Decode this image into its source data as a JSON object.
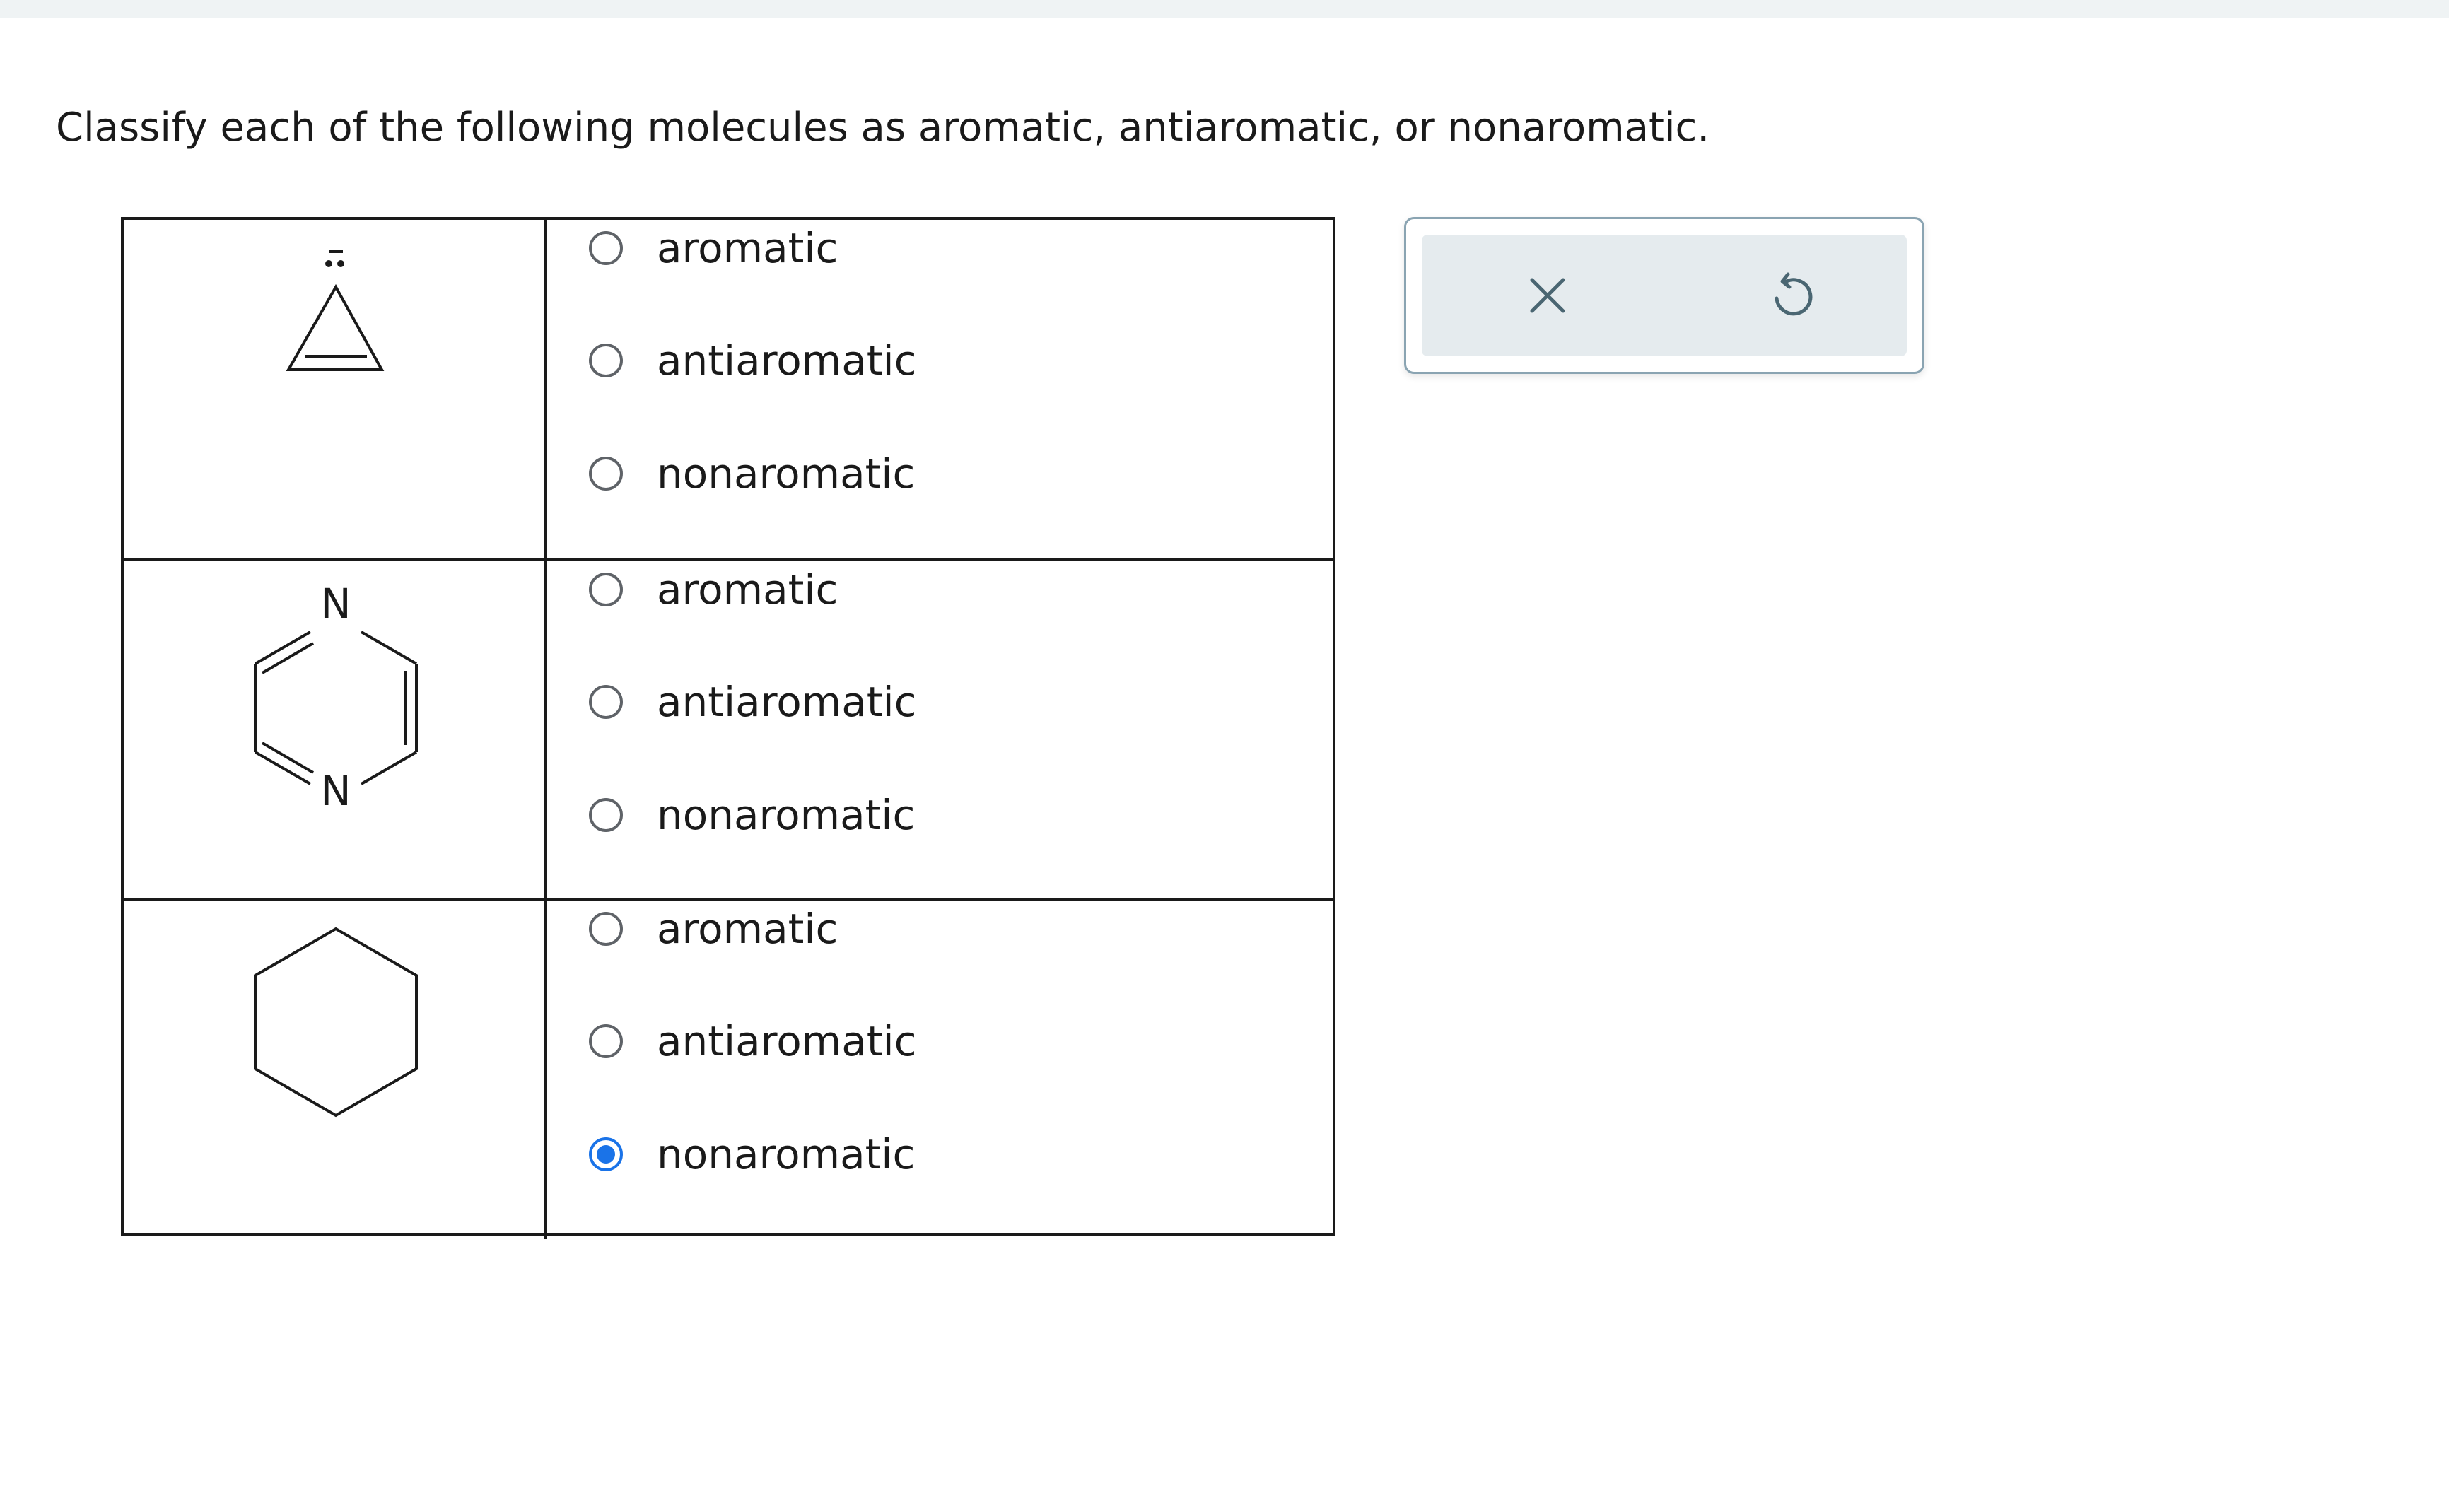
{
  "question": "Classify each of the following molecules as aromatic, antiaromatic, or nonaromatic.",
  "rows": [
    {
      "molecule_icon": "cyclopropenyl-anion-icon",
      "options": [
        {
          "label": "aromatic",
          "checked": false
        },
        {
          "label": "antiaromatic",
          "checked": false
        },
        {
          "label": "nonaromatic",
          "checked": false
        }
      ]
    },
    {
      "molecule_icon": "pyrazine-icon",
      "atom_label_top": "N",
      "atom_label_bottom": "N",
      "options": [
        {
          "label": "aromatic",
          "checked": false
        },
        {
          "label": "antiaromatic",
          "checked": false
        },
        {
          "label": "nonaromatic",
          "checked": false
        }
      ]
    },
    {
      "molecule_icon": "cyclohexane-icon",
      "options": [
        {
          "label": "aromatic",
          "checked": false
        },
        {
          "label": "antiaromatic",
          "checked": false
        },
        {
          "label": "nonaromatic",
          "checked": true
        }
      ]
    }
  ],
  "toolbar": {
    "clear_icon": "close-icon",
    "undo_icon": "undo-icon"
  },
  "colors": {
    "accent": "#1a73e8",
    "panel_border": "#8aa4b2",
    "panel_fill": "#e5ebee",
    "icon": "#4a6672"
  }
}
